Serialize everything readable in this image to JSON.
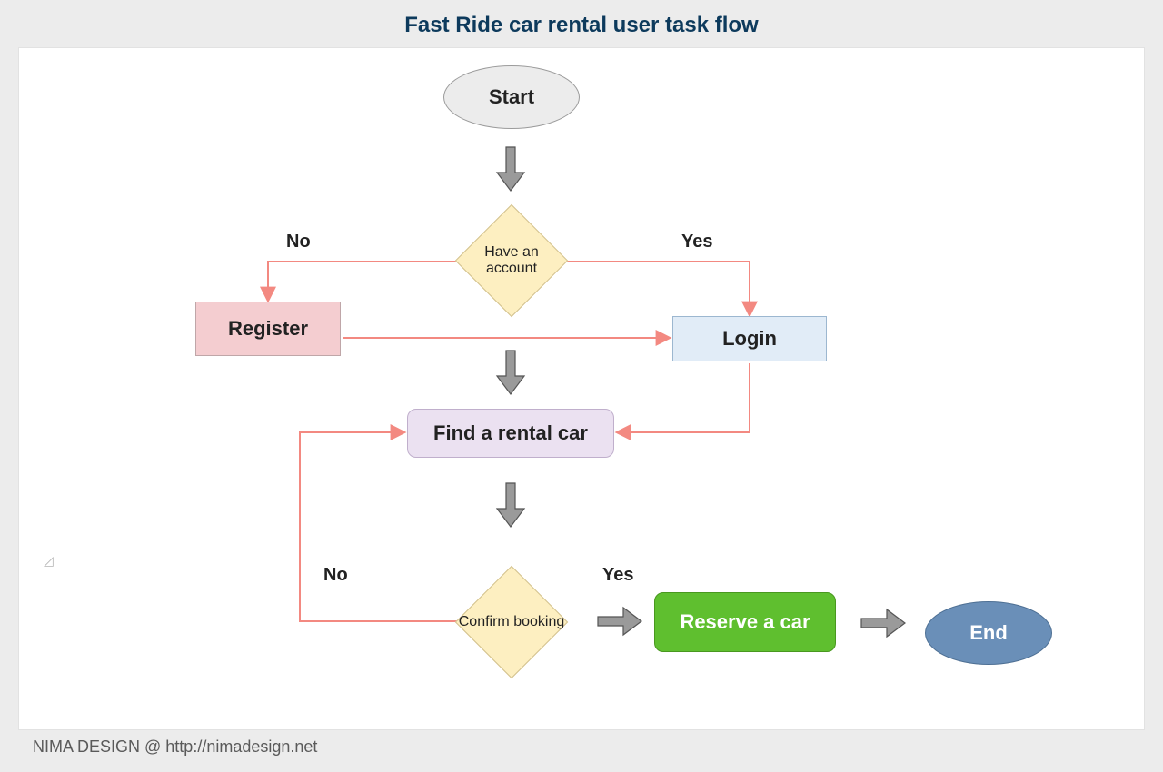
{
  "title": "Fast Ride car rental user task flow",
  "footer": "NIMA DESIGN @ http://nimadesign.net",
  "nodes": {
    "start": "Start",
    "end": "End",
    "account": "Have an account",
    "register": "Register",
    "login": "Login",
    "find": "Find a rental  car",
    "confirm": "Confirm booking",
    "reserve": "Reserve a car"
  },
  "edges": {
    "account_no": "No",
    "account_yes": "Yes",
    "confirm_no": "No",
    "confirm_yes": "Yes"
  },
  "colors": {
    "canvas_bg": "#ececec",
    "title_color": "#0d3a5c",
    "arrow_line": "#f38981",
    "arrow_block_fill": "#9a9a9a",
    "arrow_block_stroke": "#555555",
    "node_start_bg": "#ececec",
    "node_register_bg": "#f4cdd0",
    "node_login_bg": "#e1ecf7",
    "node_find_bg": "#ebe1f1",
    "node_reserve_bg": "#5fbf2f",
    "node_end_bg": "#6a8fb8",
    "diamond_bg": "#fdefc1"
  }
}
